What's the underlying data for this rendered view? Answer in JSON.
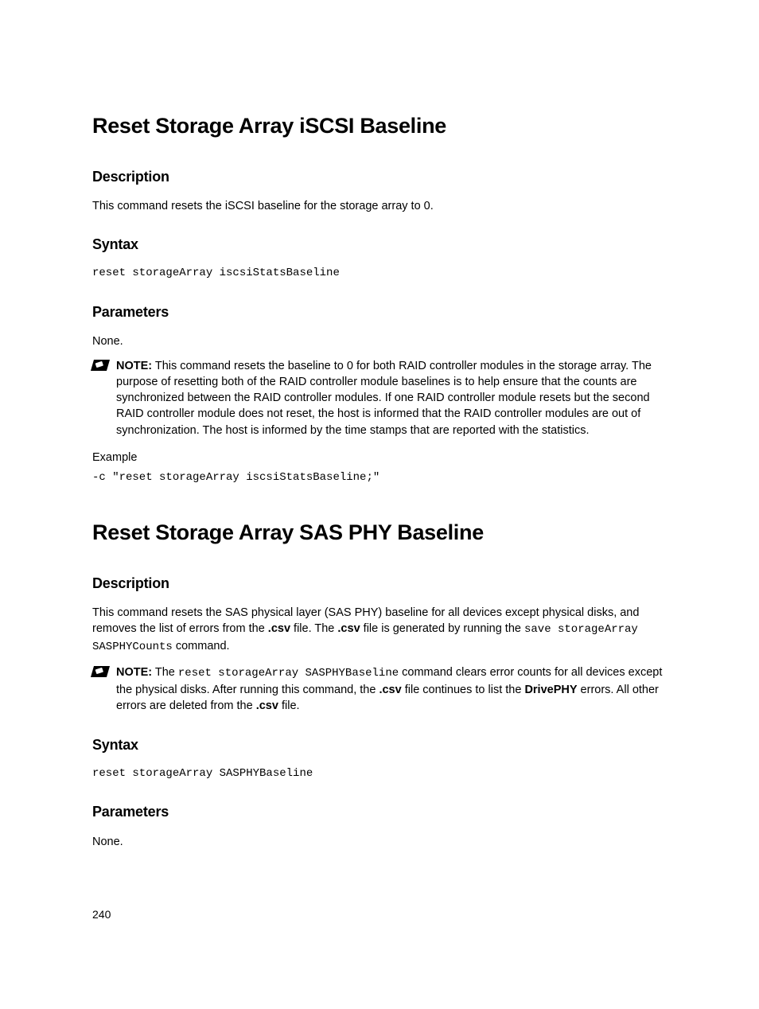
{
  "section1": {
    "title": "Reset Storage Array iSCSI Baseline",
    "desc_h": "Description",
    "desc_text": "This command resets the iSCSI baseline for the storage array to 0.",
    "syntax_h": "Syntax",
    "syntax_code": "reset storageArray iscsiStatsBaseline",
    "params_h": "Parameters",
    "params_text": "None.",
    "note_label": "NOTE:",
    "note_text": " This command resets the baseline to 0 for both RAID controller modules in the storage array. The purpose of resetting both of the RAID controller module baselines is to help ensure that the counts are synchronized between the RAID controller modules. If one RAID controller module resets but the second RAID controller module does not reset, the host is informed that the RAID controller modules are out of synchronization. The host is informed by the time stamps that are reported with the statistics.",
    "example_label": "Example",
    "example_code": "-c \"reset storageArray iscsiStatsBaseline;\""
  },
  "section2": {
    "title": "Reset Storage Array SAS PHY Baseline",
    "desc_h": "Description",
    "desc_p1a": "This command resets the SAS physical layer (SAS PHY) baseline for all devices except physical disks, and removes the list of errors from the ",
    "csv": ".csv",
    "desc_p1b": " file. The ",
    "desc_p1c": " file is generated by running the ",
    "save_cmd": "save storageArray SASPHYCounts",
    "desc_p1d": " command.",
    "note_label": "NOTE:",
    "note_a": " The ",
    "reset_cmd": "reset storageArray SASPHYBaseline",
    "note_b": " command clears error counts for all devices except the physical disks. After running this command, the ",
    "note_c": " file continues to list the ",
    "drivephy": "DrivePHY",
    "note_d": " errors. All other errors are deleted from the ",
    "note_e": " file.",
    "syntax_h": "Syntax",
    "syntax_code": "reset storageArray SASPHYBaseline",
    "params_h": "Parameters",
    "params_text": "None."
  },
  "page_number": "240"
}
